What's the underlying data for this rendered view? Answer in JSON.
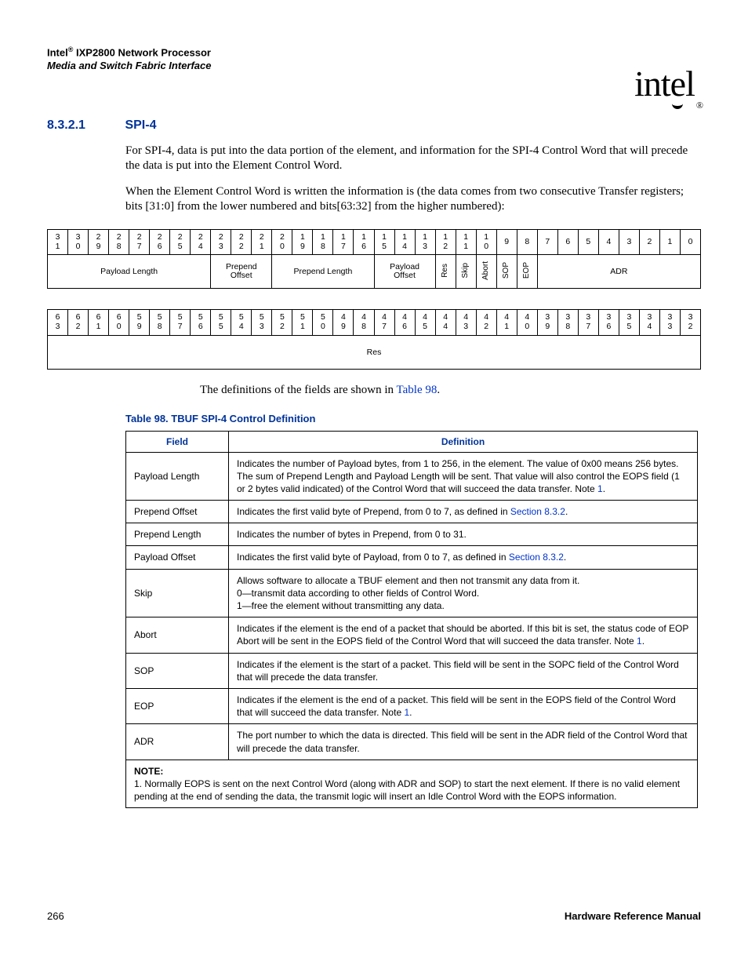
{
  "header": {
    "brand_prefix": "Intel",
    "reg": "®",
    "product": " IXP2800 Network Processor",
    "subtitle": "Media and Switch Fabric Interface",
    "logo_text": "int",
    "logo_e": "e",
    "logo_l": "l",
    "logo_reg": "®"
  },
  "section": {
    "number": "8.3.2.1",
    "title": "SPI-4"
  },
  "para1": "For SPI-4, data is put into the data portion of the element, and information for the SPI-4 Control Word that will precede the data is put into the Element Control Word.",
  "para2": "When the Element Control Word is written the information is (the data comes from two consecutive Transfer registers; bits [31:0] from the lower numbered and bits[63:32] from the higher numbered):",
  "bits1": {
    "nums": [
      "3\n1",
      "3\n0",
      "2\n9",
      "2\n8",
      "2\n7",
      "2\n6",
      "2\n5",
      "2\n4",
      "2\n3",
      "2\n2",
      "2\n1",
      "2\n0",
      "1\n9",
      "1\n8",
      "1\n7",
      "1\n6",
      "1\n5",
      "1\n4",
      "1\n3",
      "1\n2",
      "1\n1",
      "1\n0",
      "9",
      "8",
      "7",
      "6",
      "5",
      "4",
      "3",
      "2",
      "1",
      "0"
    ],
    "fields": [
      {
        "span": 8,
        "label": "Payload Length",
        "vertical": false
      },
      {
        "span": 3,
        "label": "Prepend Offset",
        "vertical": false
      },
      {
        "span": 5,
        "label": "Prepend Length",
        "vertical": false
      },
      {
        "span": 3,
        "label": "Payload Offset",
        "vertical": false
      },
      {
        "span": 1,
        "label": "Res",
        "vertical": true
      },
      {
        "span": 1,
        "label": "Skip",
        "vertical": true
      },
      {
        "span": 1,
        "label": "Abort",
        "vertical": true
      },
      {
        "span": 1,
        "label": "SOP",
        "vertical": true
      },
      {
        "span": 1,
        "label": "EOP",
        "vertical": true
      },
      {
        "span": 8,
        "label": "ADR",
        "vertical": false
      }
    ]
  },
  "bits2": {
    "nums": [
      "6\n3",
      "6\n2",
      "6\n1",
      "6\n0",
      "5\n9",
      "5\n8",
      "5\n7",
      "5\n6",
      "5\n5",
      "5\n4",
      "5\n3",
      "5\n2",
      "5\n1",
      "5\n0",
      "4\n9",
      "4\n8",
      "4\n7",
      "4\n6",
      "4\n5",
      "4\n4",
      "4\n3",
      "4\n2",
      "4\n1",
      "4\n0",
      "3\n9",
      "3\n8",
      "3\n7",
      "3\n6",
      "3\n5",
      "3\n4",
      "3\n3",
      "3\n2"
    ],
    "field_label": "Res"
  },
  "ref_prefix": "The definitions of the fields are shown in ",
  "ref_link": "Table 98",
  "ref_suffix": ".",
  "table_caption": "Table 98.  TBUF SPI-4 Control Definition",
  "def_headers": {
    "field": "Field",
    "definition": "Definition"
  },
  "defs": [
    {
      "field": "Payload Length",
      "parts": [
        {
          "t": "Indicates the number of Payload bytes, from 1 to 256, in the element. The value of 0x00 means 256 bytes. The sum of Prepend Length and Payload Length will be sent. That value will also control the EOPS field (1 or 2 bytes valid indicated) of the Control Word that will succeed the data transfer. Note "
        },
        {
          "t": "1",
          "link": true
        },
        {
          "t": "."
        }
      ]
    },
    {
      "field": "Prepend Offset",
      "parts": [
        {
          "t": "Indicates the first valid byte of Prepend, from 0 to 7, as defined in "
        },
        {
          "t": "Section 8.3.2",
          "link": true
        },
        {
          "t": "."
        }
      ]
    },
    {
      "field": "Prepend Length",
      "parts": [
        {
          "t": "Indicates the number of bytes in Prepend, from 0 to 31."
        }
      ]
    },
    {
      "field": "Payload Offset",
      "parts": [
        {
          "t": "Indicates the first valid byte of Payload, from 0 to 7, as defined in "
        },
        {
          "t": "Section 8.3.2",
          "link": true
        },
        {
          "t": "."
        }
      ]
    },
    {
      "field": "Skip",
      "parts": [
        {
          "t": "Allows software to allocate a TBUF element and then not transmit any data from it.\n0—transmit data according to other fields of Control Word.\n1—free the element without transmitting any data."
        }
      ]
    },
    {
      "field": "Abort",
      "parts": [
        {
          "t": "Indicates if the element is the end of a packet that should be aborted. If this bit is set, the status code of EOP Abort will be sent in the EOPS field of the Control Word that will succeed the data transfer. Note "
        },
        {
          "t": "1",
          "link": true
        },
        {
          "t": "."
        }
      ]
    },
    {
      "field": "SOP",
      "parts": [
        {
          "t": "Indicates if the element is the start of a packet. This field will be sent in the SOPC field of the Control Word that will precede the data transfer."
        }
      ]
    },
    {
      "field": "EOP",
      "parts": [
        {
          "t": "Indicates if the element is the end of a packet. This field will be sent in the EOPS field of the Control Word that will succeed the data transfer. Note "
        },
        {
          "t": "1",
          "link": true
        },
        {
          "t": "."
        }
      ]
    },
    {
      "field": "ADR",
      "parts": [
        {
          "t": "The port number to which the data is directed. This field will be sent in the ADR field of the Control Word that will precede the data transfer."
        }
      ]
    }
  ],
  "note": {
    "heading": "NOTE:",
    "body": "1. Normally EOPS is sent on the next Control Word (along with ADR and SOP) to start the next element. If there is no valid element pending at the end of sending the data, the transmit logic will insert an Idle Control Word with the EOPS information."
  },
  "footer": {
    "page": "266",
    "doc": "Hardware Reference Manual"
  }
}
